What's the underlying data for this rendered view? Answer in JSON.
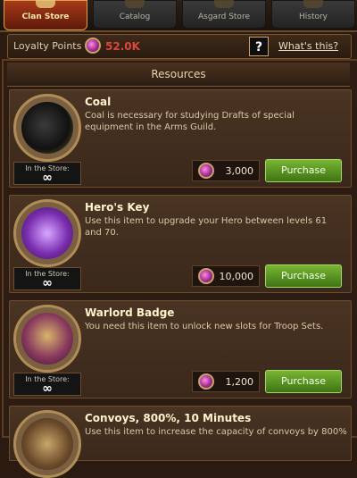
{
  "tabs": [
    {
      "label": "Clan Store",
      "active": true
    },
    {
      "label": "Catalog",
      "active": false
    },
    {
      "label": "Asgard Store",
      "active": false
    },
    {
      "label": "History",
      "active": false
    }
  ],
  "loyalty": {
    "label": "Loyalty Points",
    "value": "52.0K",
    "help": "?",
    "link": "What's this?"
  },
  "section": {
    "title": "Resources"
  },
  "items": [
    {
      "name": "Coal",
      "description": "Coal is necessary for studying Drafts of special equipment in the Arms Guild.",
      "store_label": "In the Store:",
      "store_value": "∞",
      "price": "3,000",
      "button": "Purchase",
      "icon": "coal-icon"
    },
    {
      "name": "Hero's Key",
      "description": "Use this item to upgrade your Hero between levels 61 and 70.",
      "store_label": "In the Store:",
      "store_value": "∞",
      "price": "10,000",
      "button": "Purchase",
      "icon": "key-icon"
    },
    {
      "name": "Warlord Badge",
      "description": "You need this item to unlock new slots for Troop Sets.",
      "store_label": "In the Store:",
      "store_value": "∞",
      "price": "1,200",
      "button": "Purchase",
      "icon": "badge-icon"
    },
    {
      "name": "Convoys, 800%, 10 Minutes",
      "description": "Use this item to increase the capacity of convoys by 800%",
      "icon": "convoy-icon"
    }
  ],
  "colors": {
    "accent": "#a83a18",
    "purchase": "#5e9a24",
    "loyalty_value": "#e0453b"
  }
}
